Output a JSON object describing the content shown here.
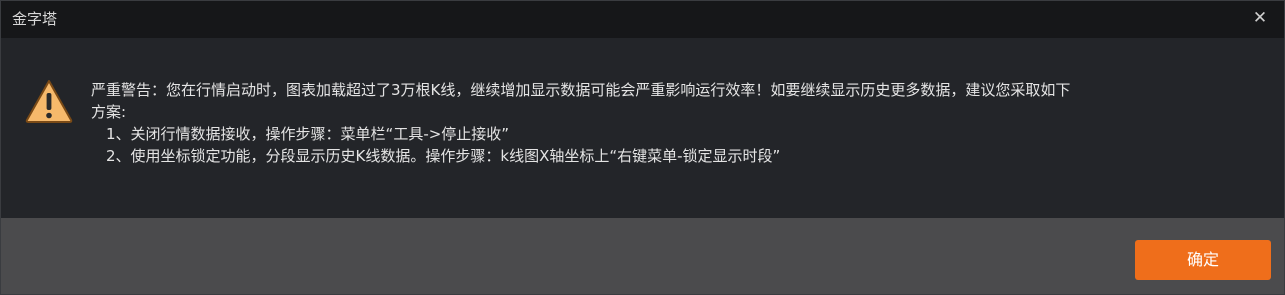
{
  "window": {
    "title": "金字塔",
    "close_glyph": "✕"
  },
  "message": {
    "line1": "严重警告：您在行情启动时，图表加载超过了3万根K线，继续增加显示数据可能会严重影响运行效率！如要继续显示历史更多数据，建议您采取如下",
    "line2": "方案:",
    "steps": [
      "1、关闭行情数据接收，操作步骤：菜单栏“工具->停止接收”",
      "2、使用坐标锁定功能，分段显示历史K线数据。操作步骤：k线图X轴坐标上“右键菜单-锁定显示时段”"
    ]
  },
  "icon": {
    "name": "warning-icon",
    "fill_color": "#f6b96b",
    "stroke_color": "#7a4a16"
  },
  "buttons": {
    "ok_label": "确定",
    "ok_color": "#ef6e1b"
  }
}
